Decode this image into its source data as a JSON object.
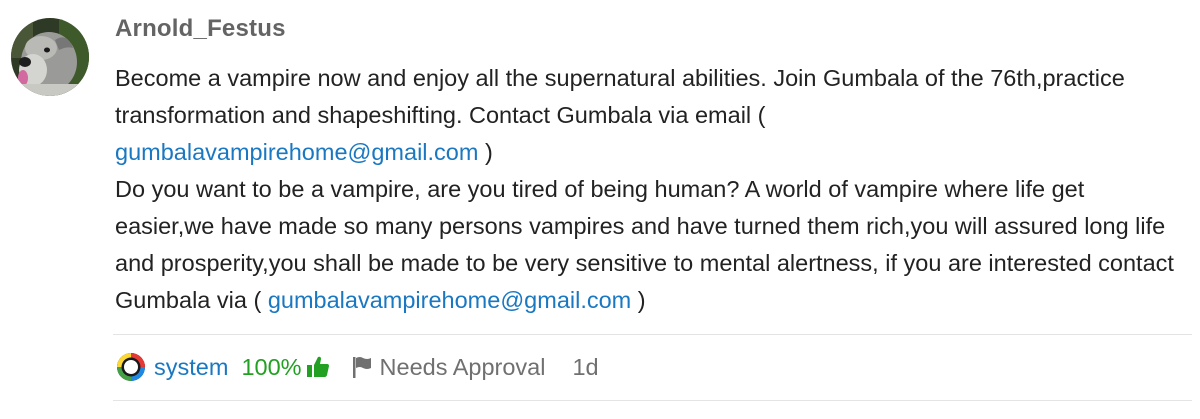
{
  "post": {
    "author": "Arnold_Festus",
    "paragraph1_text": "Become a vampire now and enjoy all the supernatural abilities. Join Gumbala of the 76th,practice transformation and shapeshifting. Contact Gumbala via email (",
    "paragraph1_email": "gumbalavampirehome@gmail.com",
    "paragraph1_close": ")",
    "paragraph2_text": "Do you want to be a vampire, are you tired of being human? A world of vampire where life get easier,we have made so many persons vampires and have turned them rich,you will assured long life and prosperity,you shall be made to be very sensitive to mental alertness, if you are interested contact Gumbala via (",
    "paragraph2_email": "gumbalavampirehome@gmail.com",
    "paragraph2_close": ")"
  },
  "footer": {
    "user_label": "system",
    "score": "100%",
    "status_label": "Needs Approval",
    "time_ago": "1d"
  },
  "icons": {
    "avatar": "dog-avatar",
    "system": "system-logo-icon",
    "thumb": "thumbs-up-icon",
    "flag": "flag-icon"
  },
  "colors": {
    "link": "#1a78c2",
    "score": "#22a022",
    "muted": "#707070",
    "username": "#646464"
  }
}
